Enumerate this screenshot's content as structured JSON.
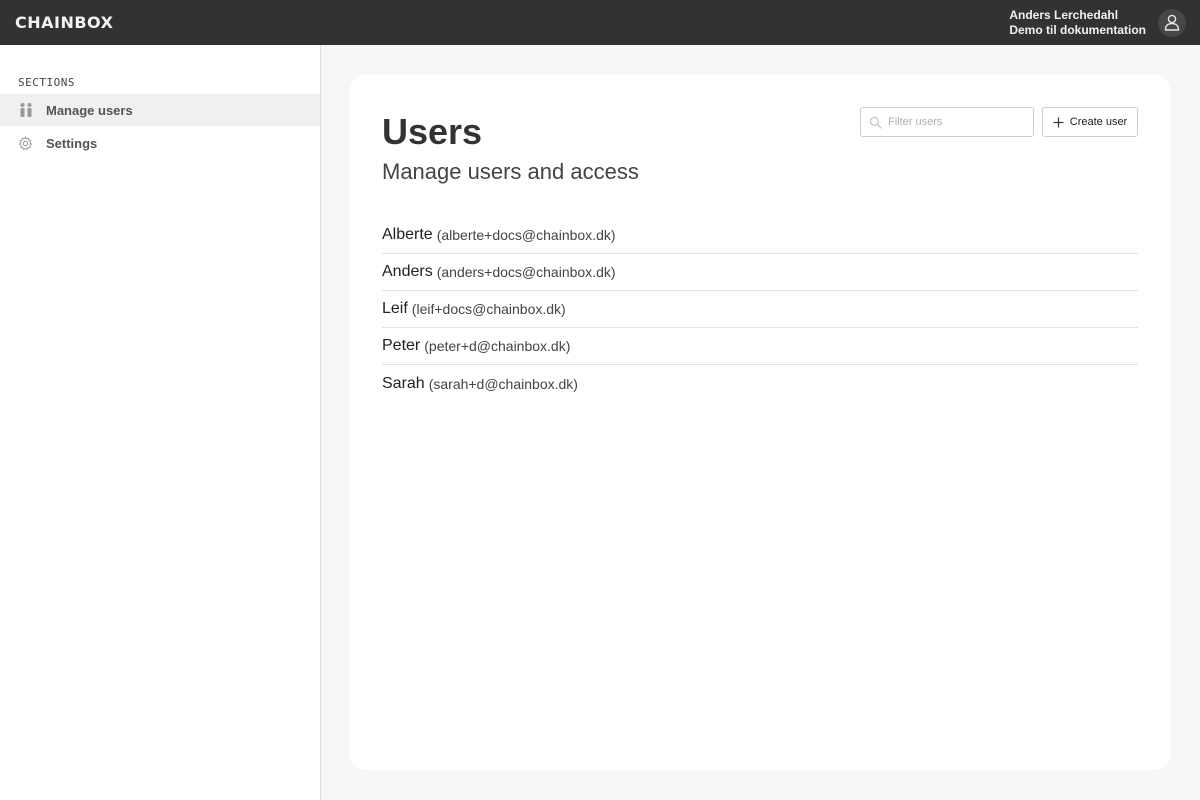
{
  "header": {
    "logo": "CHAINBOX",
    "user_name": "Anders Lerchedahl",
    "organization": "Demo til dokumentation",
    "avatar_icon": "user-icon"
  },
  "sidebar": {
    "section_title": "SECTIONS",
    "items": [
      {
        "label": "Manage users",
        "icon": "users-icon",
        "active": true
      },
      {
        "label": "Settings",
        "icon": "gear-icon",
        "active": false
      }
    ]
  },
  "main": {
    "title": "Users",
    "subtitle": "Manage users and access",
    "filter": {
      "placeholder": "Filter users",
      "value": ""
    },
    "create_button_label": "Create user",
    "users": [
      {
        "name": "Alberte",
        "email": "(alberte+docs@chainbox.dk)"
      },
      {
        "name": "Anders",
        "email": "(anders+docs@chainbox.dk)"
      },
      {
        "name": "Leif",
        "email": "(leif+docs@chainbox.dk)"
      },
      {
        "name": "Peter",
        "email": "(peter+d@chainbox.dk)"
      },
      {
        "name": "Sarah",
        "email": "(sarah+d@chainbox.dk)"
      }
    ]
  },
  "colors": {
    "topbar": "#323232",
    "active_nav": "#f0f0f0",
    "card": "#ffffff",
    "background": "#f7f7f7"
  }
}
